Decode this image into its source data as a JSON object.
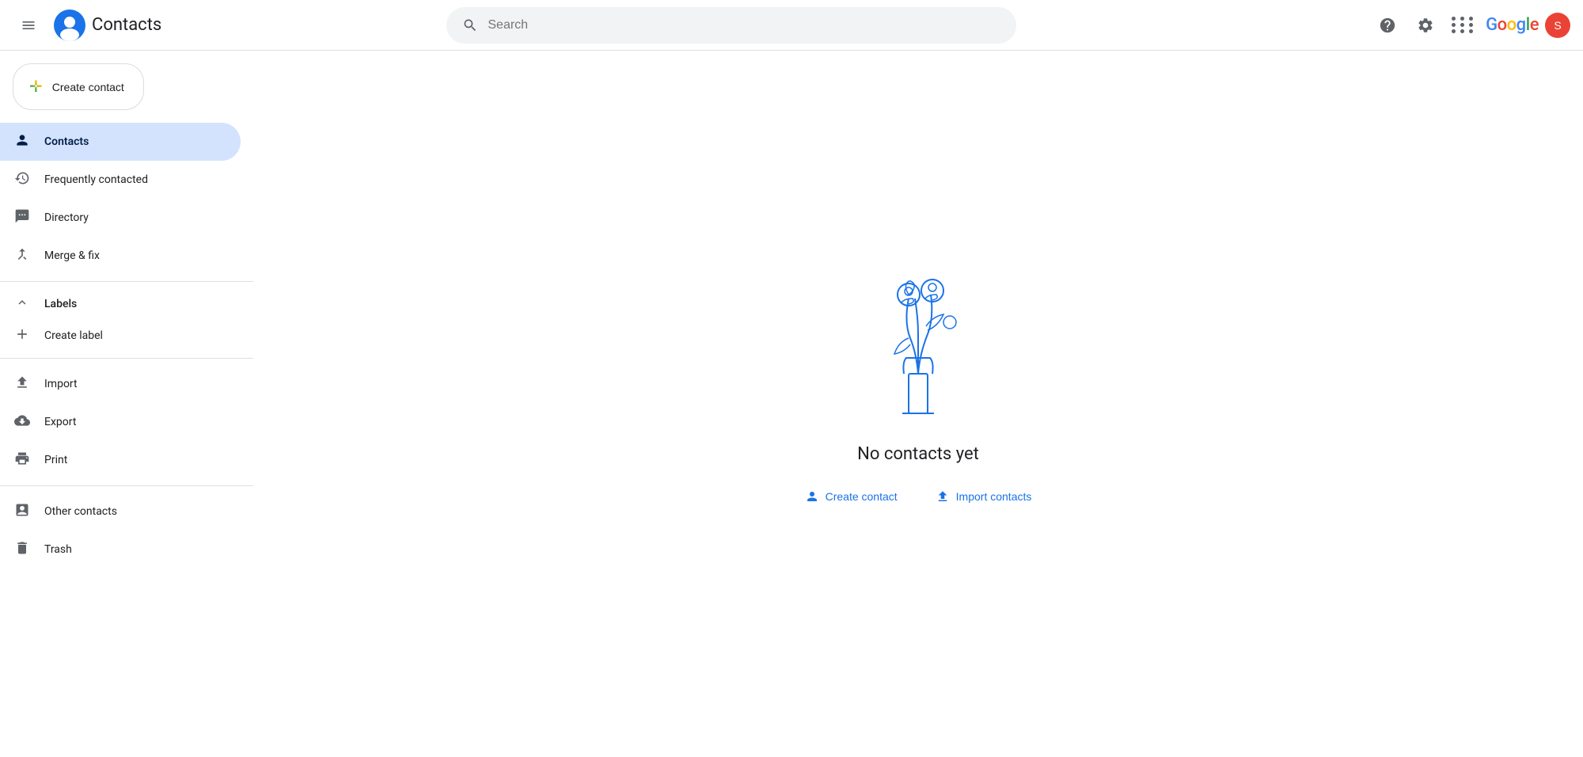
{
  "header": {
    "menu_label": "Main menu",
    "app_name": "Contacts",
    "search_placeholder": "Search",
    "help_label": "Help",
    "settings_label": "Settings",
    "apps_label": "Google apps",
    "google_label": "Google",
    "user_initial": "S"
  },
  "sidebar": {
    "create_contact_label": "Create contact",
    "nav_items": [
      {
        "id": "contacts",
        "label": "Contacts",
        "icon": "person",
        "active": true
      },
      {
        "id": "frequently-contacted",
        "label": "Frequently contacted",
        "icon": "history"
      },
      {
        "id": "directory",
        "label": "Directory",
        "icon": "grid"
      },
      {
        "id": "merge-fix",
        "label": "Merge & fix",
        "icon": "merge"
      }
    ],
    "labels_header": "Labels",
    "create_label": "Create label",
    "import_label": "Import",
    "export_label": "Export",
    "print_label": "Print",
    "other_contacts_label": "Other contacts",
    "trash_label": "Trash"
  },
  "main": {
    "empty_title": "No contacts yet",
    "create_contact_link": "Create contact",
    "import_contacts_link": "Import contacts"
  },
  "colors": {
    "active_bg": "#d3e3fd",
    "active_text": "#041e49",
    "link_color": "#1a73e8",
    "icon_color": "#5f6368"
  }
}
